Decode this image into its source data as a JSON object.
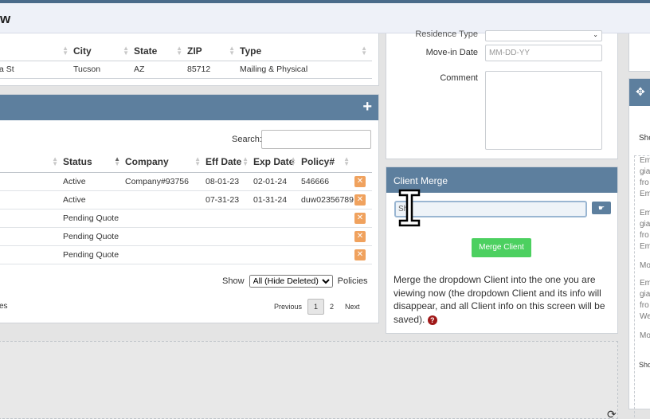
{
  "header": {
    "title": "w"
  },
  "address": {
    "columns": [
      "City",
      "State",
      "ZIP",
      "Type"
    ],
    "row": {
      "street": "a St",
      "city": "Tucson",
      "state": "AZ",
      "zip": "85712",
      "type": "Mailing & Physical"
    }
  },
  "policies": {
    "search_label": "Search:",
    "columns": [
      "Status",
      "Company",
      "Eff Date",
      "Exp Date",
      "Policy#"
    ],
    "rows": [
      {
        "status": "Active",
        "company": "Company#93756",
        "eff": "08-01-23",
        "exp": "02-01-24",
        "policy": "546666"
      },
      {
        "status": "Active",
        "company": "",
        "eff": "07-31-23",
        "exp": "01-31-24",
        "policy": "duw02356789"
      },
      {
        "status": "Pending Quote",
        "company": "",
        "eff": "",
        "exp": "",
        "policy": ""
      },
      {
        "status": "Pending Quote",
        "company": "",
        "eff": "",
        "exp": "",
        "policy": ""
      },
      {
        "status": "Pending Quote",
        "company": "",
        "eff": "",
        "exp": "",
        "policy": ""
      }
    ],
    "show_label": "Show",
    "show_selected": "All (Hide Deleted)",
    "show_suffix": "Policies",
    "footer_fragment": "es",
    "pager": {
      "previous": "Previous",
      "pages": [
        "1",
        "2"
      ],
      "next": "Next"
    }
  },
  "client_form": {
    "residence_type_label": "Residence Type",
    "move_in_label": "Move-in Date",
    "move_in_placeholder": "MM-DD-YY",
    "comment_label": "Comment"
  },
  "client_merge": {
    "title": "Client Merge",
    "input_value": "Sh",
    "button_label": "Merge Client",
    "description": "Merge the dropdown Client into the one you are viewing now (the dropdown Client and its info will disappear, and all Client info on this screen will be saved)."
  },
  "notes": {
    "show_top": "Sho",
    "entries": [
      "Em",
      "gia",
      "fro",
      "Em",
      "Em",
      "gia",
      "fro",
      "Em",
      "Mo",
      "Em",
      "gia",
      "fro",
      "We",
      "Mo"
    ],
    "show_bottom": "Show"
  },
  "colors": {
    "header_blue": "#5d7f9e",
    "merge_green": "#4cd060",
    "edit_orange": "#f0a25e"
  }
}
